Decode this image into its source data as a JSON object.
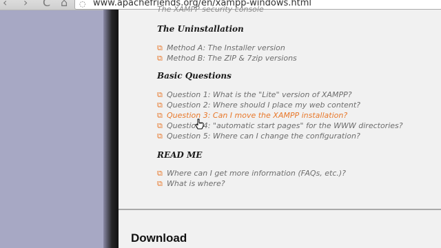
{
  "browser": {
    "back_icon": "arrow-left-icon",
    "back_glyph": "‹",
    "forward_glyph": "›",
    "reload_glyph": "C",
    "home_glyph": "⌂",
    "url": "www.apachefriends.org/en/xampp-windows.html"
  },
  "content": {
    "cut_text": "The XAMPP security console",
    "sections": [
      {
        "title": "The Uninstallation",
        "items": [
          "Method A: The Installer version",
          "Method B: The ZIP & 7zip versions"
        ]
      },
      {
        "title": "Basic Questions",
        "items": [
          "Question 1: What is the \"Lite\" version of XAMPP?",
          "Question 2: Where should I place my web content?",
          "Question 3: Can I move the XAMPP installation?",
          "Question 4: \"automatic start pages\" for the WWW directories?",
          "Question 5: Where can I change the configuration?"
        ]
      },
      {
        "title": "READ ME",
        "items": [
          "Where can I get more information (FAQs, etc.)?",
          "What is where?"
        ]
      }
    ],
    "hovered_item": "Question 3: Can I move the XAMPP installation?",
    "download_heading": "Download"
  },
  "colors": {
    "link": "#6d6d6d",
    "link_hover": "#e8782a",
    "sidebar": "#a7a8c4",
    "content_bg": "#f1f1f1"
  },
  "icons": {
    "link_icon": "external-link-icon",
    "link_glyph": "⧉"
  }
}
